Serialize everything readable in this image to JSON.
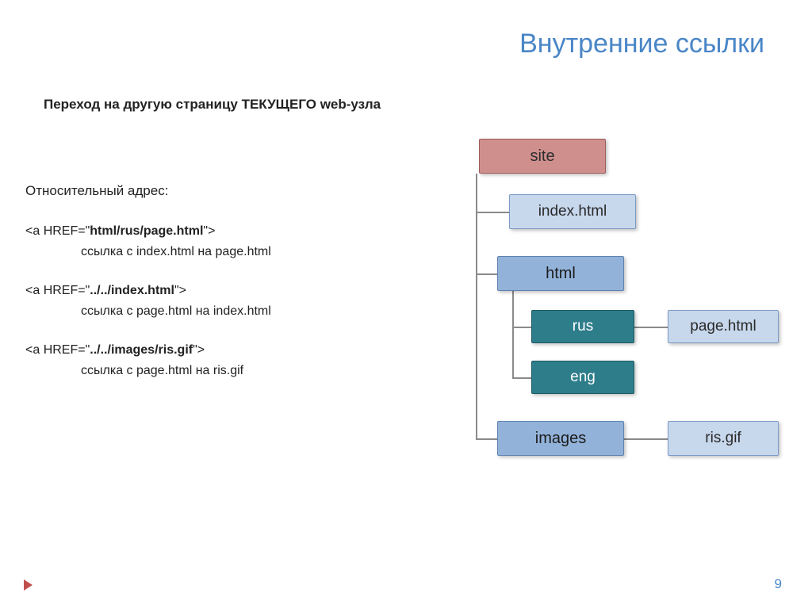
{
  "title": "Внутренние ссылки",
  "subtitle": "Переход на другую страницу ТЕКУЩЕГО web-узла",
  "left": {
    "rel_label": "Относительный адрес:",
    "ex1_code_prefix": "<a HREF=\"",
    "ex1_code_path": "html/rus/page.html",
    "ex1_code_suffix": "\">",
    "ex1_desc": "ссылка с index.html на page.html",
    "ex2_code_prefix": "<a HREF=\"",
    "ex2_code_path": "../../index.html",
    "ex2_code_suffix": "\">",
    "ex2_desc": "ссылка с page.html на index.html",
    "ex3_code_prefix": "<a HREF=\"",
    "ex3_code_path": "../../images/ris.gif",
    "ex3_code_suffix": "\">",
    "ex3_desc": "ссылка с page.html на ris.gif"
  },
  "nodes": {
    "site": "site",
    "index": "index.html",
    "html": "html",
    "rus": "rus",
    "eng": "eng",
    "images": "images",
    "page": "page.html",
    "ris": "ris.gif"
  },
  "page_number": "9"
}
